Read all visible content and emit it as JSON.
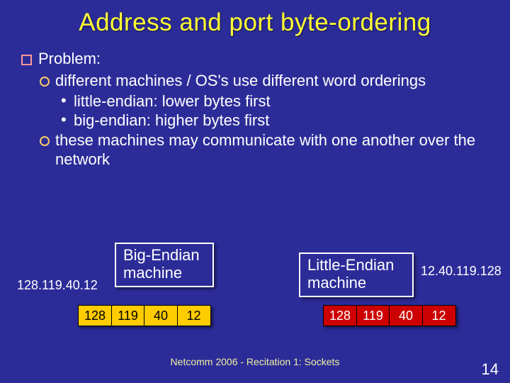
{
  "title": "Address and port byte-ordering",
  "bullets": {
    "problem": "Problem:",
    "diff": "different machines / OS's use different word orderings",
    "le": "little-endian: lower bytes first",
    "be": "big-endian: higher bytes first",
    "comm": "these machines may communicate with one another over the network"
  },
  "diagram": {
    "big_label": "Big-Endian machine",
    "little_label": "Little-Endian machine",
    "ip_left": "128.119.40.12",
    "ip_right": "12.40.119.128",
    "big_bytes": [
      "128",
      "119",
      "40",
      "12"
    ],
    "little_bytes": [
      "128",
      "119",
      "40",
      "12"
    ]
  },
  "footer": "Netcomm 2006  -  Recitation 1: Sockets",
  "page": "14"
}
